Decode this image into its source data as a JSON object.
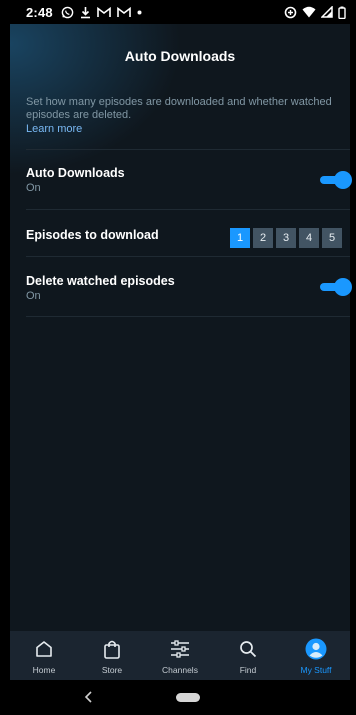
{
  "status_bar": {
    "time": "2:48",
    "left_icons": [
      "whatsapp-icon",
      "download-icon",
      "gmail-icon",
      "gmail-icon",
      "dot-icon"
    ],
    "right_icons": [
      "data-saver-icon",
      "wifi-icon",
      "signal-icon",
      "battery-icon"
    ]
  },
  "header": {
    "title": "Auto Downloads"
  },
  "intro": {
    "text": "Set how many episodes are downloaded and whether watched episodes are deleted.",
    "learn_more": "Learn more"
  },
  "settings": {
    "auto_downloads": {
      "title": "Auto Downloads",
      "status": "On",
      "enabled": true
    },
    "episodes_to_download": {
      "title": "Episodes to download",
      "options": [
        "1",
        "2",
        "3",
        "4",
        "5"
      ],
      "selected": "1"
    },
    "delete_watched": {
      "title": "Delete watched episodes",
      "status": "On",
      "enabled": true
    }
  },
  "bottom_nav": {
    "items": [
      {
        "label": "Home",
        "icon": "home-icon"
      },
      {
        "label": "Store",
        "icon": "shopping-bag-icon"
      },
      {
        "label": "Channels",
        "icon": "channels-icon"
      },
      {
        "label": "Find",
        "icon": "search-icon"
      },
      {
        "label": "My Stuff",
        "icon": "profile-icon"
      }
    ],
    "active": "My Stuff"
  },
  "colors": {
    "accent": "#1a98ff",
    "background": "#0f171e",
    "nav_background": "#1b2530",
    "link": "#79b8f3",
    "muted_text": "#8197a4"
  }
}
